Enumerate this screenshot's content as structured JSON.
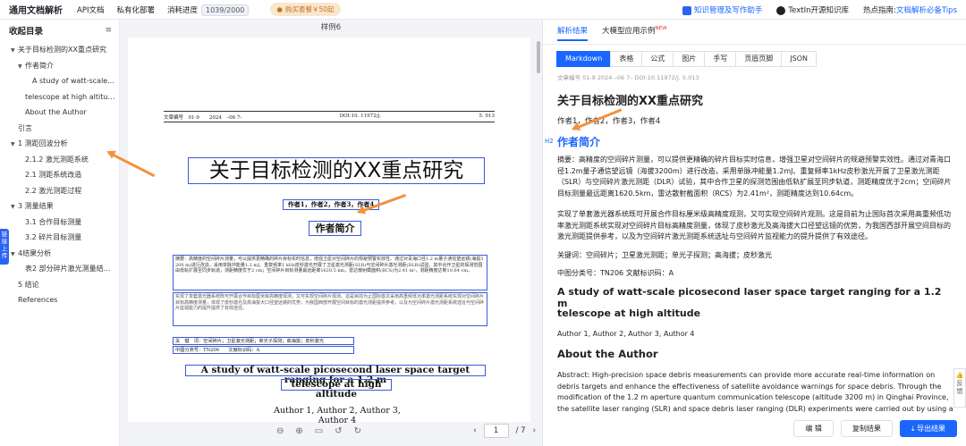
{
  "topbar": {
    "brand": "通用文档解析",
    "api": "API文档",
    "private": "私有化部署",
    "usage_label": "消耗进度",
    "usage_value": "1039/2000",
    "promo": "购买套餐￥50起",
    "kb_link": "知识管理及写作助手",
    "oss_link": "TextIn开源知识库",
    "hot_label": "热点指南:",
    "hot_link": "文档解析必备Tips"
  },
  "sidebar": {
    "title": "收起目录",
    "side_tab": "链接上传",
    "items": [
      {
        "label": "关于目标检测的XX重点研究",
        "caret": "▼",
        "indent": 0
      },
      {
        "label": "作者简介",
        "caret": "▼",
        "indent": 1
      },
      {
        "label": "A study of watt-scale...",
        "caret": "",
        "indent": 2
      },
      {
        "label": "telescope at high altitude",
        "caret": "",
        "indent": 1
      },
      {
        "label": "About the Author",
        "caret": "",
        "indent": 1
      },
      {
        "label": "引言",
        "caret": "",
        "indent": 0
      },
      {
        "label": "1 测距回波分析",
        "caret": "▼",
        "indent": 0
      },
      {
        "label": "2.1.2 激光测距系统",
        "caret": "",
        "indent": 1
      },
      {
        "label": "2.1 测距系统改造",
        "caret": "",
        "indent": 1
      },
      {
        "label": "2.2 激光测距过程",
        "caret": "",
        "indent": 1
      },
      {
        "label": "3 测量结果",
        "caret": "▼",
        "indent": 0
      },
      {
        "label": "3.1 合作目标测量",
        "caret": "",
        "indent": 1
      },
      {
        "label": "3.2 碎片目标测量",
        "caret": "",
        "indent": 1
      },
      {
        "label": "4结果分析",
        "caret": "▼",
        "indent": 0
      },
      {
        "label": "表2 部分碎片激光测量结...",
        "caret": "",
        "indent": 1
      },
      {
        "label": "5 结论",
        "caret": "",
        "indent": 0
      },
      {
        "label": "References",
        "caret": "",
        "indent": 0
      }
    ]
  },
  "viewer": {
    "title": "样例6",
    "header_left": "文章编号　01-9　　2024　–06 7-",
    "header_mid": "DOI:10. 11972/j.",
    "header_right": "5. 013",
    "doc_title": "关于目标检测的XX重点研究",
    "authors": "作者1，作者2，作者3，作者4",
    "section": "作者简介",
    "abstract": "摘要：高精度的空间碎片测量，可以提供更精确的碎片目标实时信息，增强卫星对空间碎片的规避预警实效性。通过对青海口径1.2 m量子通信望远镜(海拔3 200 m)进行改造，采用单脉冲能量1.2 mJ、重复频率1 kHz皮秒激光开展了卫星激光测距(SLR)与空间碎片激光测距(DLR)试验，其中合作卫星的探测范围由低轨扩展至同步轨道，测距精度优于2 cm；空间碎片目标测量最远距离1620.5 km，雷达散射截面积(RCS)为2.41 m²，测距精度达到10.64 cm。",
    "abstract2": "实现了单套激光器系统既可开展合作目标厘米级高精度观测，又可实现空间碎片观测。这是目前为止国际首次采用高重频低功率激光测距系统实现对空间碎片目标高精度测量，体现了皮秒激光及高海拔大口径望远镜的优势，为我国西部开展空间目标的激光测距提供参考，以及为空间碎片激光测距系统选址与空间碎片监视能力的提升提供了有效途径。",
    "keywords": "关　键　词：空间碎片；卫星激光测距；单光子探测；高海拔；皮秒激光",
    "classification": "中图分类号：TN206　　文献标识码：A",
    "en_title_1": "A study of watt-scale picosecond laser space target ranging for a 1.2 m",
    "en_title_2": "telescope at high altitude",
    "en_authors": "Author 1, Author 2, Author 3, Author 4",
    "page_current": "1",
    "page_total": "/ 7"
  },
  "result": {
    "tabs": [
      "解析结果",
      "大模型应用示例"
    ],
    "new_badge": "NEW",
    "formats": [
      "Markdown",
      "表格",
      "公式",
      "图片",
      "手写",
      "页眉页脚",
      "JSON"
    ],
    "meta": "文章编号 01-9 2024 –06 7– DOI:10.11972/j. 5.013",
    "h1": "关于目标检测的XX重点研究",
    "authors": "作者1，作者2，作者3，作者4",
    "h2_tag": "H2",
    "h2": "作者简介",
    "p1": "摘要：高精度的空间碎片测量，可以提供更精确的碎片目标实时信息，增强卫星对空间碎片的规避预警实效性。通过对青海口径1.2m量子通信望远镜（海拔3200m）进行改造，采用单脉冲能量1.2mJ、重复频率1kHz皮秒激光开展了卫星激光测距（SLR）与空间碎片激光测距（DLR）试验，其中合作卫星的探测范围由低轨扩展至同步轨道，测距精度优于2cm；空间碎片目标测量最远距离1620.5km，雷达散射截面积（RCS）为2.41m²，测距精度达到10.64cm。",
    "p2": "实现了单套激光器系统既可开展合作目标厘米级高精度观测，又可实现空间碎片观测。这是目前为止国际首次采用高重频低功率激光测距系统实现对空间碎片目标高精度测量，体现了皮秒激光及高海拔大口径望远镜的优势，为我国西部开展空间目标的激光测距提供参考，以及为空间碎片激光测距系统选址与空间碎片监视能力的提升提供了有效途径。",
    "keywords": "关键词：空间碎片；卫星激光测距；单光子探测；高海拔；皮秒激光",
    "classification": "中图分类号：TN206 文献标识码：A",
    "en1": "A study of watt-scale picosecond laser space target ranging for a 1.2 m",
    "en2": "telescope at high altitude",
    "en_authors": "Author 1, Author 2, Author 3, Author 4",
    "about": "About the Author",
    "abstract_en": "Abstract: High-precision space debris measurements can provide more accurate real-time information on debris targets and enhance the effectiveness of satellite avoidance warnings for space debris. Through the modification of the 1.2 m aperture quantum communication telescope (altitude 3200 m) in Qinghai Province, the satellite laser ranging (SLR) and space debris laser ranging (DLR) experiments were carried out by using a single pulse energy of",
    "feedback": "反馈",
    "btn_edit": "编 辑",
    "btn_copy": "复制结果",
    "btn_export": "导出结果"
  },
  "colors": {
    "accent": "#1a66ff",
    "arrow": "#f0923e",
    "box": "#3a5bd9"
  }
}
